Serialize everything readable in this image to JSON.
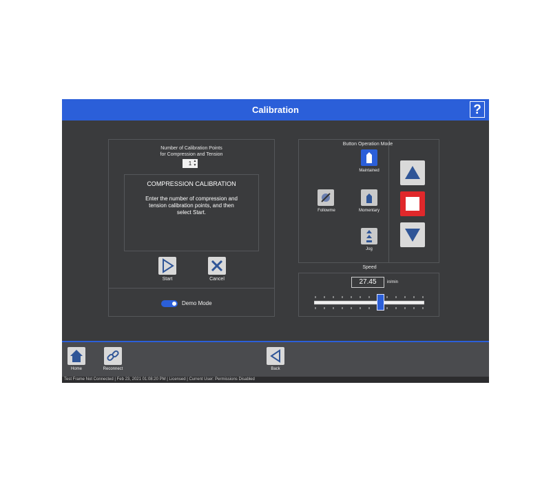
{
  "window": {
    "title": "Calibration",
    "help_label": "?"
  },
  "calibration_points": {
    "label_line1": "Number of Calibration Points",
    "label_line2": "for Compression and Tension",
    "value": "1"
  },
  "message": {
    "heading": "COMPRESSION CALIBRATION",
    "body_line1": "Enter the number of compression and",
    "body_line2": "tension calibration points, and then",
    "body_line3": "select Start."
  },
  "actions": {
    "start_label": "Start",
    "cancel_label": "Cancel"
  },
  "demo_mode": {
    "label": "Demo Mode",
    "enabled": true
  },
  "button_mode": {
    "title": "Button Operation Mode",
    "followme_label": "Followme",
    "maintained_label": "Maintained",
    "momentary_label": "Momentary",
    "jog_label": "Jog",
    "selected": "Maintained"
  },
  "speed": {
    "title": "Speed",
    "value": "27.45",
    "unit": "in/min",
    "slider_fraction": 0.6
  },
  "bottom_nav": {
    "home_label": "Home",
    "reconnect_label": "Reconnect",
    "back_label": "Back"
  },
  "status_bar": {
    "text": "Test Frame Not Connected   |   Feb 23, 2021 01:08:20 PM   |   Licensed   |   Current User: Permissions Disabled"
  },
  "colors": {
    "accent": "#2b5fd9",
    "background": "#3a3b3d",
    "stop_red": "#e0282b"
  },
  "icons": [
    "help-icon",
    "start-play-icon",
    "cancel-x-icon",
    "followme-icon",
    "maintained-icon",
    "momentary-icon",
    "jog-icon",
    "up-arrow-icon",
    "stop-icon",
    "down-arrow-icon",
    "home-icon",
    "reconnect-link-icon",
    "back-icon"
  ]
}
